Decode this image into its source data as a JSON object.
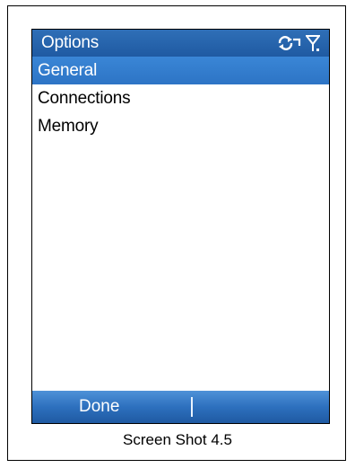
{
  "window": {
    "title": "Options"
  },
  "status_icons": [
    {
      "name": "connection-sync-icon"
    },
    {
      "name": "signal-antenna-icon"
    }
  ],
  "menu": {
    "items": [
      {
        "label": "General",
        "selected": true
      },
      {
        "label": "Connections",
        "selected": false
      },
      {
        "label": "Memory",
        "selected": false
      }
    ]
  },
  "softkeys": {
    "left_label": "Done",
    "right_label": ""
  },
  "caption": "Screen Shot 4.5",
  "colors": {
    "titlebar": "#2f6fb7",
    "selection": "#3a86d6",
    "softkey_bar": "#2d70be"
  }
}
